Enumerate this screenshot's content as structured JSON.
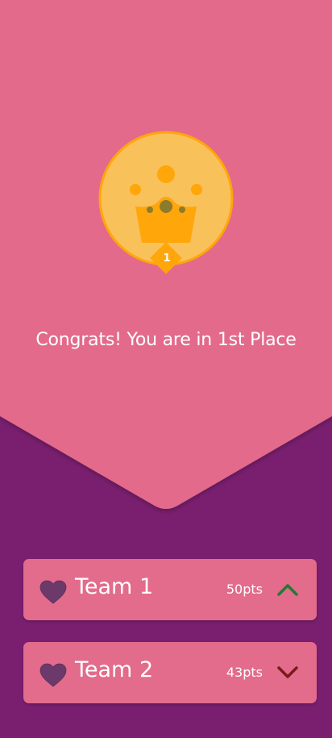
{
  "hero": {
    "rank_number": "1",
    "message": "Congrats! You are in 1st Place",
    "colors": {
      "hero_bg": "#e36b8b",
      "page_bg": "#7a1f6f",
      "badge_fill": "#f8c15a",
      "badge_ring": "#ffa60a",
      "crown": "#ffa60a",
      "jewel": "#8c7b2c"
    }
  },
  "leaderboard": [
    {
      "name": "Team 1",
      "points": "50pts",
      "trend": "up",
      "trend_icon": "chevron-up-icon",
      "trend_color": "#1e7d32"
    },
    {
      "name": "Team 2",
      "points": "43pts",
      "trend": "down",
      "trend_icon": "chevron-down-icon",
      "trend_color": "#7a1a1a"
    }
  ],
  "icons": {
    "team": "heart-icon",
    "heart_color": "#6b3a6b"
  }
}
